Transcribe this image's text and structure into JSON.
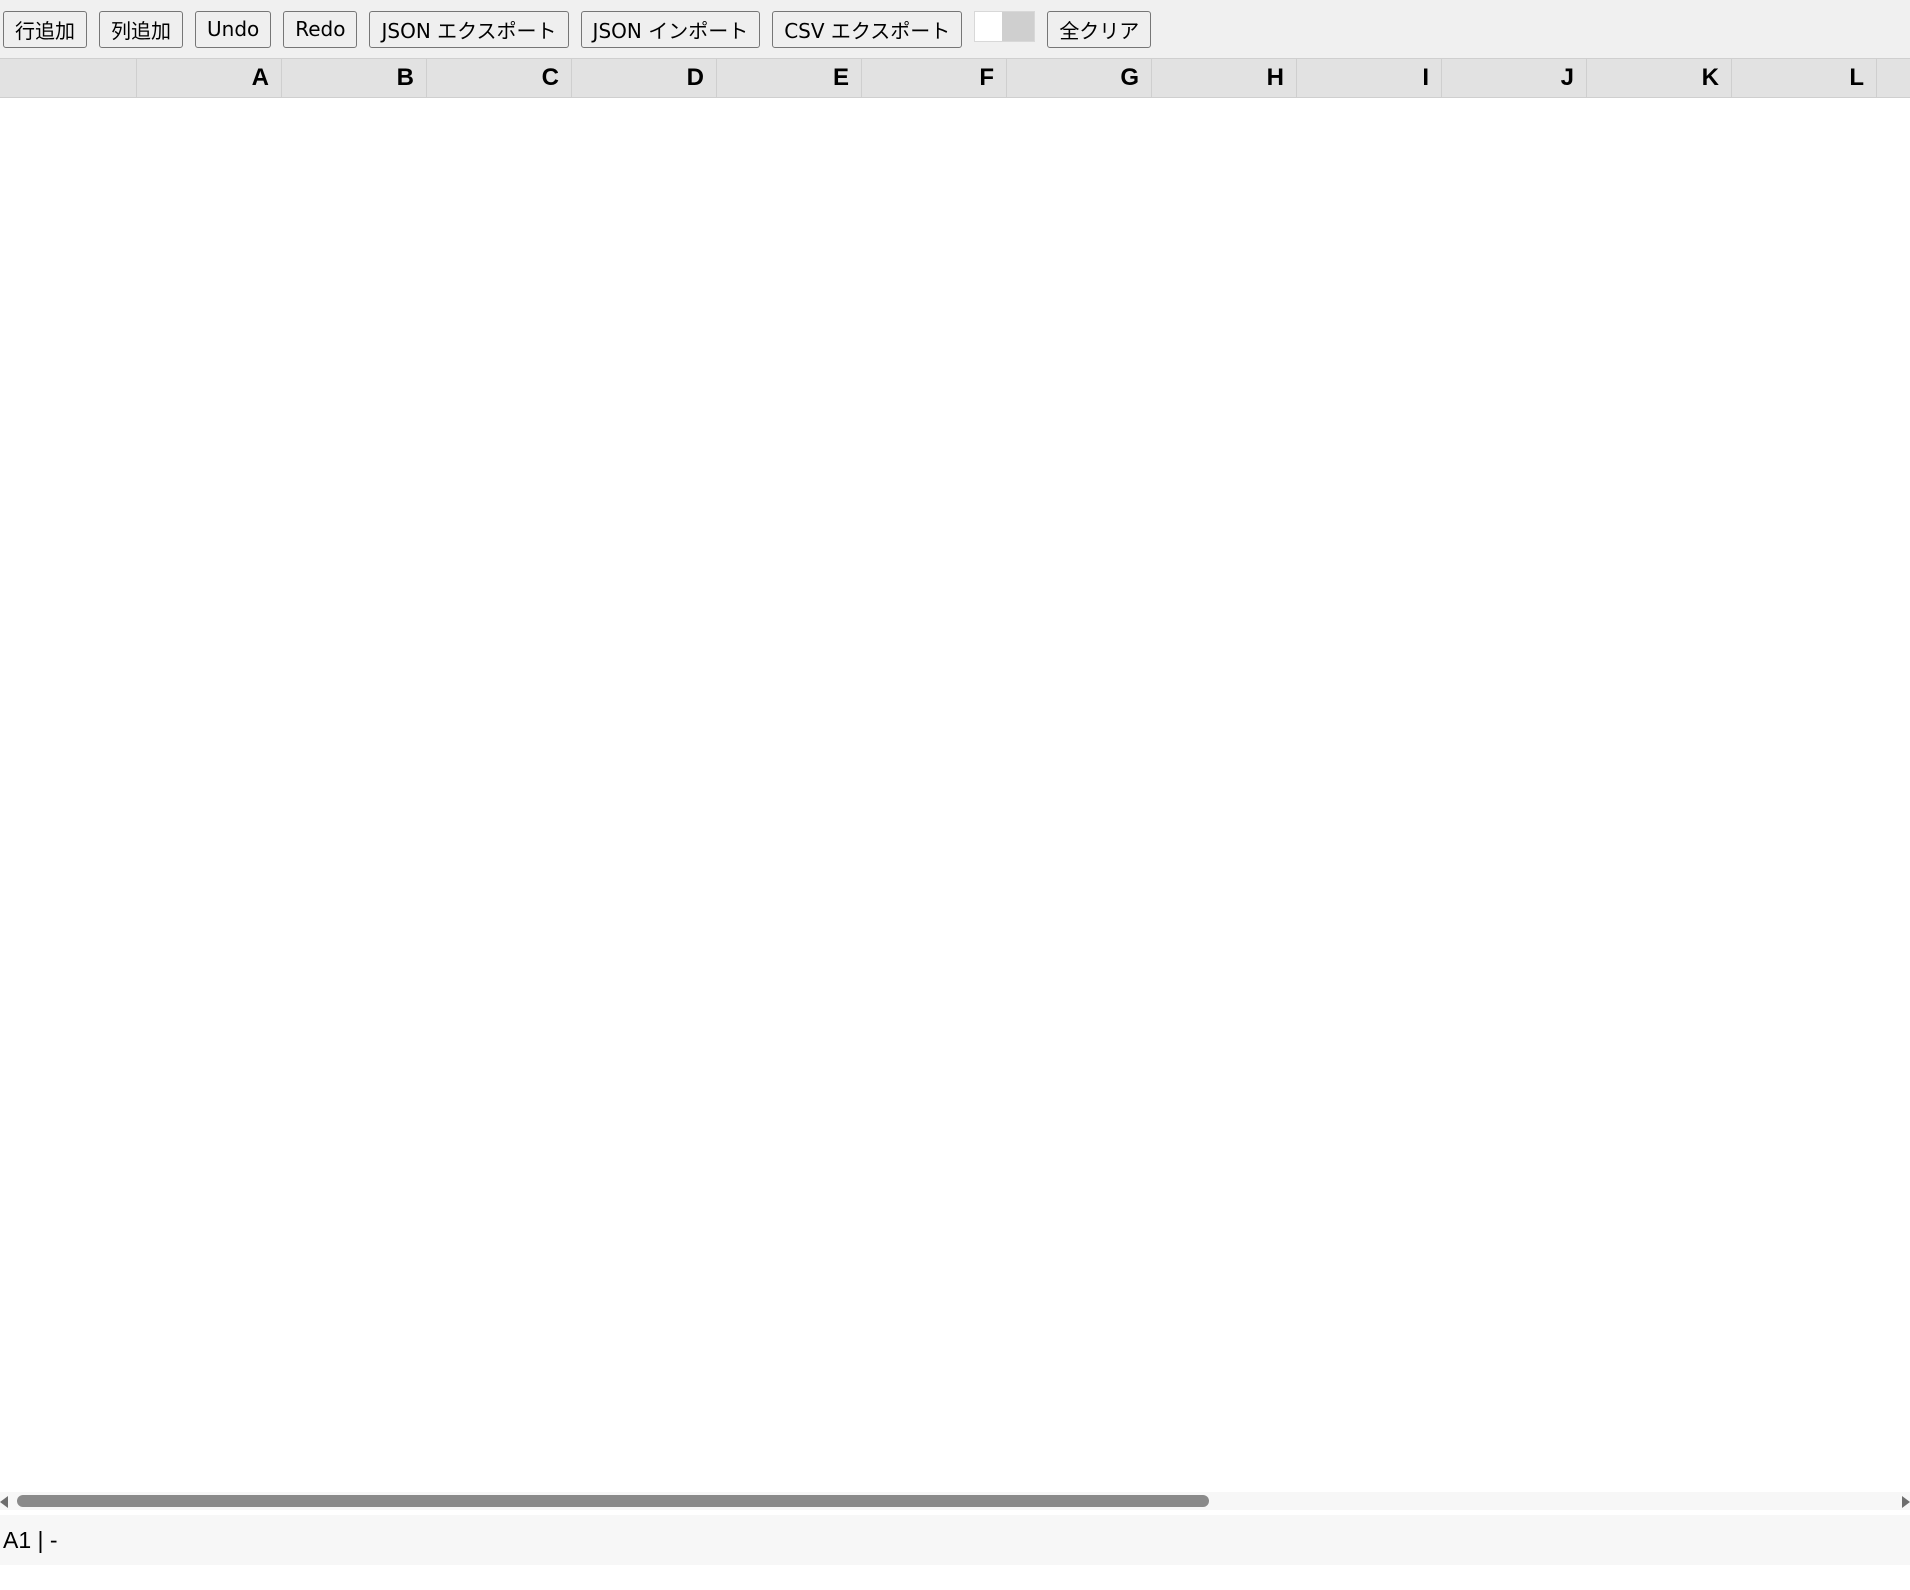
{
  "toolbar": {
    "add_row_label": "行追加",
    "add_col_label": "列追加",
    "undo_label": "Undo",
    "redo_label": "Redo",
    "json_export_label": "JSON エクスポート",
    "json_import_label": "JSON インポート",
    "csv_export_label": "CSV エクスポート",
    "color_picker_value": "#ffffff",
    "clear_all_label": "全クリア"
  },
  "columns": [
    "A",
    "B",
    "C",
    "D",
    "E",
    "F",
    "G",
    "H",
    "I",
    "J",
    "K",
    "L"
  ],
  "status": {
    "text": "A1 | -"
  }
}
